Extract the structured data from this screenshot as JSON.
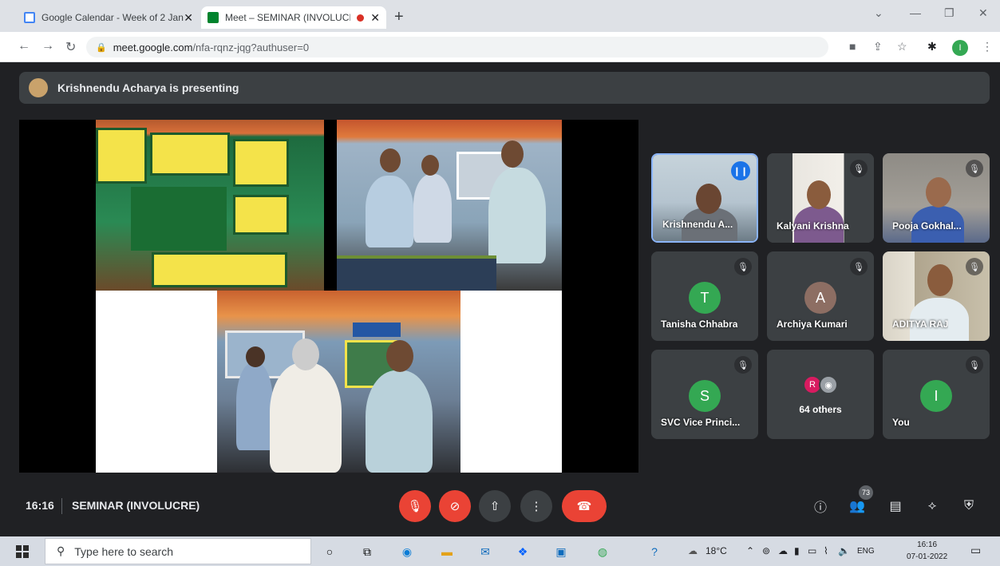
{
  "browser": {
    "tabs": [
      {
        "title": "Google Calendar - Week of 2 Jan",
        "icon": "calendar-icon"
      },
      {
        "title": "Meet – SEMINAR (INVOLUCI",
        "icon": "meet-icon",
        "recording": true
      }
    ],
    "url_host": "meet.google.com",
    "url_path": "/nfa-rqnz-jqg?authuser=0",
    "profile_initial": "I"
  },
  "meet": {
    "presenting_text": "Krishnendu Acharya is presenting",
    "participants": [
      {
        "name": "Krishnendu A...",
        "type": "video",
        "speaking": true
      },
      {
        "name": "Kalyani Krishna",
        "type": "video",
        "muted": true
      },
      {
        "name": "Pooja Gokhal...",
        "type": "video",
        "muted": true
      },
      {
        "name": "Tanisha Chhabra",
        "type": "avatar",
        "initial": "T",
        "color": "#34a853",
        "muted": true
      },
      {
        "name": "Archiya Kumari",
        "type": "avatar",
        "initial": "A",
        "color": "#8d6e63",
        "muted": true
      },
      {
        "name": "ADITYA RAJ",
        "type": "video",
        "muted": true
      },
      {
        "name": "SVC Vice Princi...",
        "type": "avatar",
        "initial": "S",
        "color": "#34a853",
        "muted": true
      },
      {
        "name": "64 others",
        "type": "others",
        "avatar_initial": "R"
      },
      {
        "name": "You",
        "type": "avatar",
        "initial": "I",
        "color": "#34a853",
        "muted": true
      }
    ],
    "time": "16:16",
    "meeting_name": "SEMINAR (INVOLUCRE)",
    "participant_count": "73"
  },
  "taskbar": {
    "search_placeholder": "Type here to search",
    "weather": "18°C",
    "language": "ENG",
    "time": "16:16",
    "date": "07-01-2022"
  },
  "colors": {
    "meet_bg": "#202124",
    "tile_bg": "#3c4043",
    "danger": "#ea4335",
    "accent": "#1a73e8"
  }
}
